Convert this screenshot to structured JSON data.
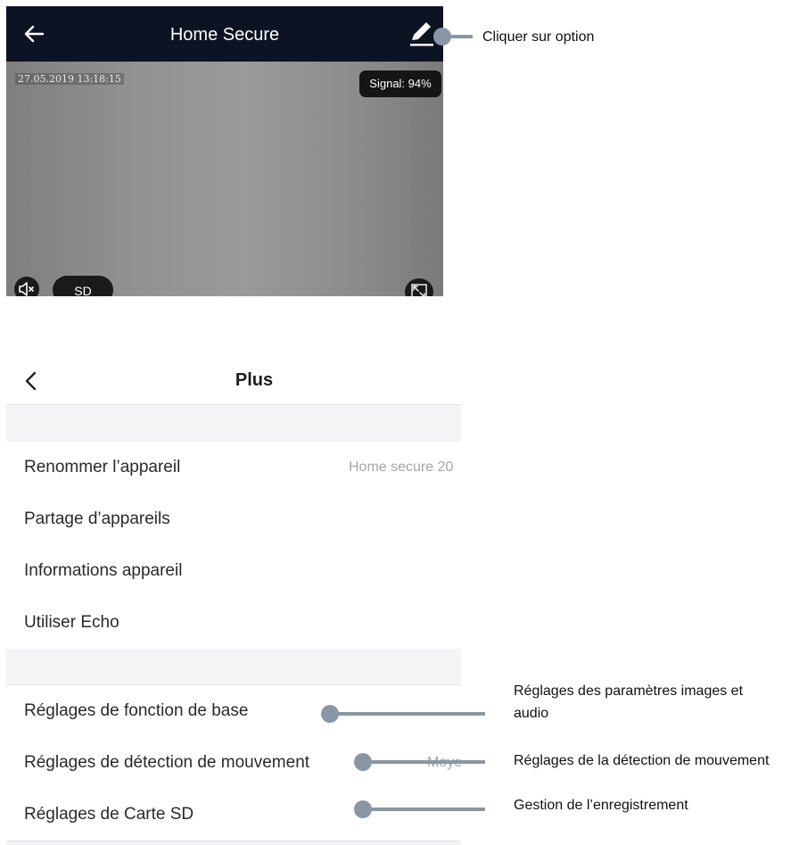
{
  "camera_screen": {
    "title": "Home Secure",
    "timestamp": "27.05.2019 13:18:15",
    "signal": "Signal: 94%",
    "quality_label": "SD",
    "icons": {
      "back": "arrow-left-icon",
      "edit": "pencil-icon",
      "mute": "speaker-muted-icon",
      "fullscreen": "fullscreen-icon"
    },
    "colors": {
      "header": "#0c1424",
      "video": "#8d8d8d"
    }
  },
  "plus_screen": {
    "title": "Plus",
    "back_icon": "chevron-left-icon",
    "items": [
      {
        "label": "Renommer l’appareil",
        "value": "Home secure 20"
      },
      {
        "label": "Partage d’appareils",
        "value": ""
      },
      {
        "label": "Informations appareil",
        "value": ""
      },
      {
        "label": "Utiliser Echo",
        "value": ""
      },
      {
        "label": "Réglages de fonction de base",
        "value": ""
      },
      {
        "label": "Réglages de détection de mouvement",
        "value": "Moyen"
      },
      {
        "label": "Réglages de Carte SD",
        "value": ""
      }
    ]
  },
  "annotations": {
    "option": "Cliquer sur option",
    "basic_settings_line1": "Réglages des paramètres images et",
    "basic_settings_line2": "audio",
    "motion": "Réglages de la détection de mouvement",
    "recording": "Gestion de l’enregistrement",
    "color": "#8a96a6"
  }
}
